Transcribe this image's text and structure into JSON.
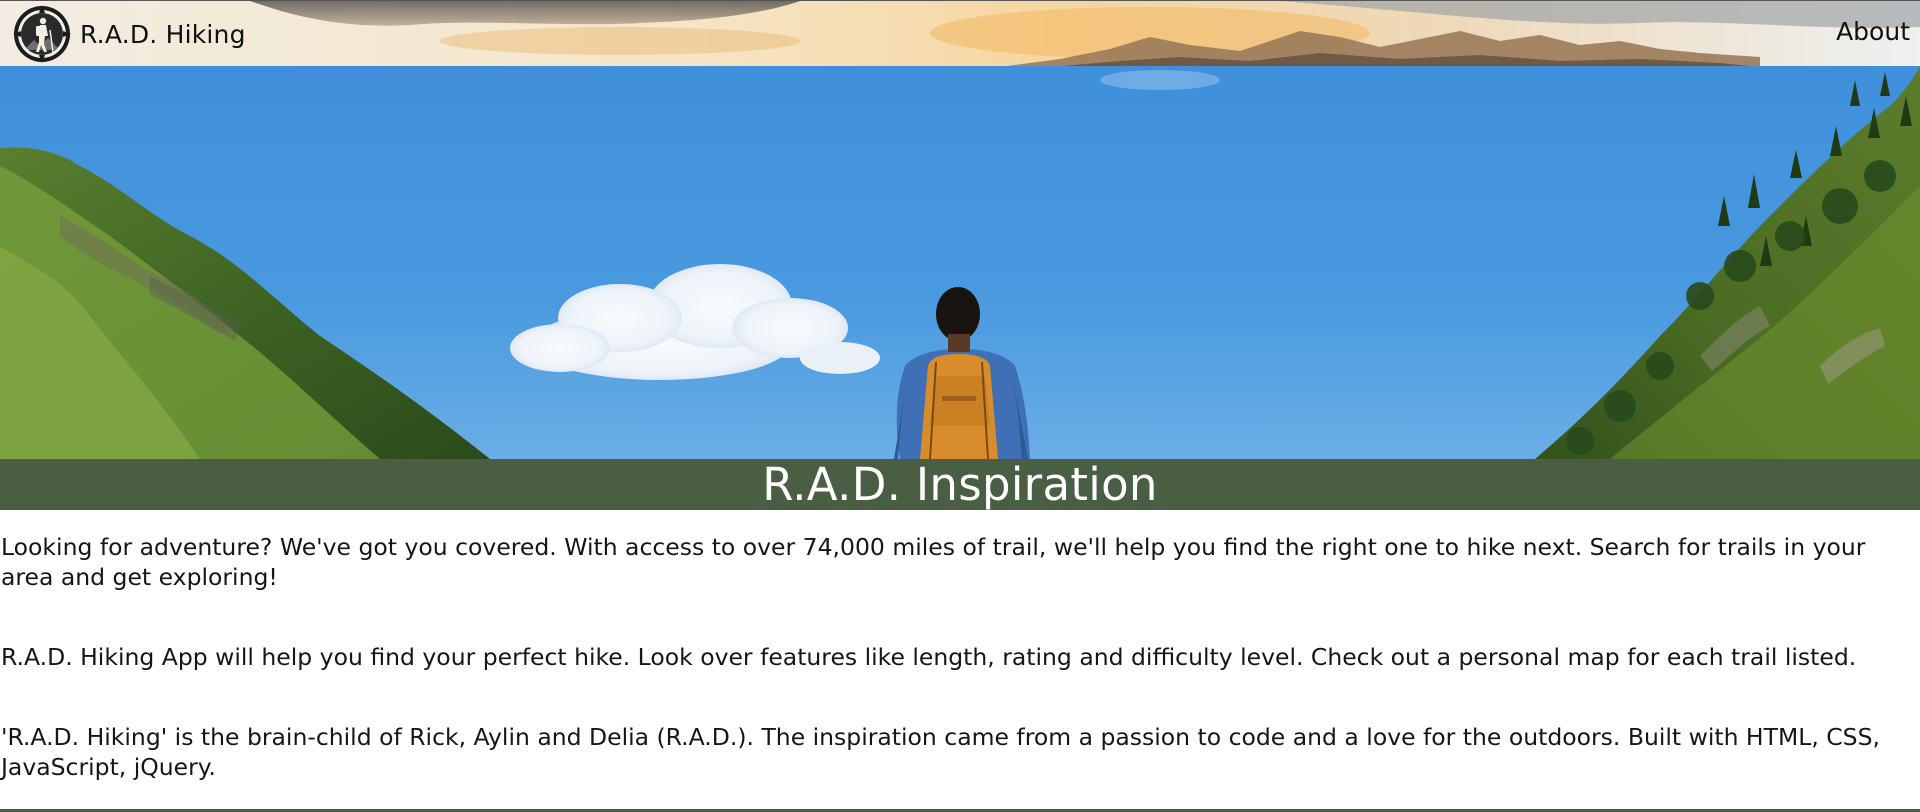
{
  "navbar": {
    "brand_name": "R.A.D. Hiking",
    "logo_icon": "compass-hiker-logo-icon",
    "about_link": "About"
  },
  "hero": {
    "image": "hiker-with-orange-backpack-mountain-valley"
  },
  "section": {
    "title": "R.A.D. Inspiration"
  },
  "content": {
    "paragraphs": [
      "Looking for adventure? We've got you covered. With access to over 74,000 miles of trail, we'll help you find the right one to hike next. Search for trails in your area and get exploring!",
      "R.A.D. Hiking App will help you find your perfect hike. Look over features like length, rating and difficulty level. Check out a personal map for each trail listed.",
      "'R.A.D. Hiking' is the brain-child of Rick, Aylin and Delia (R.A.D.). The inspiration came from a passion to code and a love for the outdoors. Built with HTML, CSS, JavaScript, jQuery."
    ]
  },
  "colors": {
    "banner_green": "#4a5e43",
    "sky_blue": "#3f8fdc",
    "backpack_orange": "#d98c2b"
  }
}
